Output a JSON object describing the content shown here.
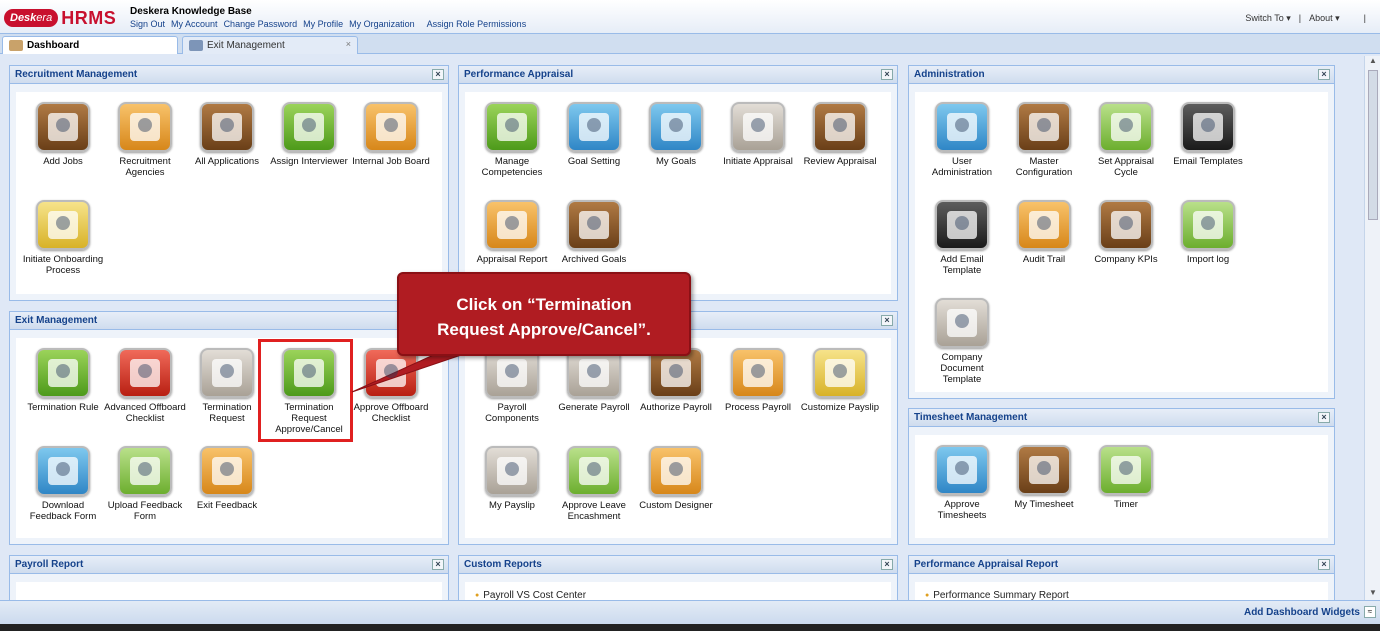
{
  "app": {
    "logo_brand": "Desk",
    "logo_era": "era",
    "logo_hrms": "HRMS",
    "title": "Deskera Knowledge Base"
  },
  "toplinks": [
    "Sign Out",
    "My Account",
    "Change Password",
    "My Profile",
    "My Organization",
    "Assign Role Permissions"
  ],
  "topright": {
    "switch_to": "Switch To ▾",
    "sep": "|",
    "about": "About ▾",
    "sep2": "|"
  },
  "tabs": [
    {
      "label": "Dashboard"
    },
    {
      "label": "Exit Management",
      "close": "×"
    }
  ],
  "panels": {
    "recruitment": {
      "title": "Recruitment Management",
      "items": [
        "Add Jobs",
        "Recruitment Agencies",
        "All Applications",
        "Assign Interviewer",
        "Internal Job Board",
        "Initiate Onboarding Process"
      ]
    },
    "performance": {
      "title": "Performance Appraisal",
      "items": [
        "Manage Competencies",
        "Goal Setting",
        "My Goals",
        "Initiate Appraisal",
        "Review Appraisal",
        "Appraisal Report",
        "Archived Goals"
      ]
    },
    "administration": {
      "title": "Administration",
      "items": [
        "User Administration",
        "Master Configuration",
        "Set Appraisal Cycle",
        "Email Templates",
        "Add Email Template",
        "Audit Trail",
        "Company KPIs",
        "Import log",
        "Company Document Template"
      ]
    },
    "exit": {
      "title": "Exit Management",
      "items": [
        "Termination Rule",
        "Advanced Offboard Checklist",
        "Termination Request",
        "Termination Request Approve/Cancel",
        "Approve Offboard Checklist",
        "Download Feedback Form",
        "Upload Feedback Form",
        "Exit Feedback"
      ]
    },
    "payroll": {
      "title": "",
      "items": [
        "Payroll Components",
        "Generate Payroll",
        "Authorize Payroll",
        "Process Payroll",
        "Customize Payslip",
        "My Payslip",
        "Approve Leave Encashment",
        "Custom Designer"
      ]
    },
    "timesheet": {
      "title": "Timesheet Management",
      "items": [
        "Approve Timesheets",
        "My Timesheet",
        "Timer"
      ]
    },
    "payroll_report": {
      "title": "Payroll Report"
    },
    "custom_reports": {
      "title": "Custom Reports",
      "items": [
        "Payroll VS Cost Center"
      ]
    },
    "perf_report": {
      "title": "Performance Appraisal Report",
      "items": [
        "Performance Summary Report"
      ]
    }
  },
  "callout": {
    "line1": "Click on “Termination",
    "line2": "Request Approve/Cancel”."
  },
  "footer": {
    "add_widgets": "Add Dashboard Widgets",
    "add_widgets_icon": "≈"
  },
  "colors": {
    "accent": "#15428b",
    "callout": "#b01c22",
    "highlight": "#e02020",
    "brand": "#c8102e"
  }
}
